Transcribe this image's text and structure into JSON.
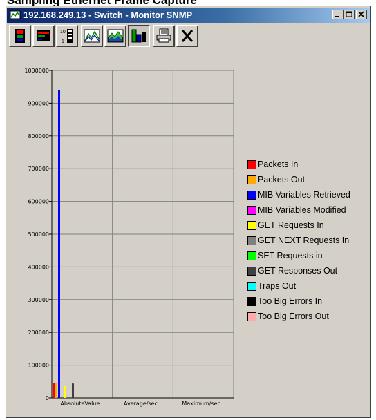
{
  "page_heading_fragment": "Sampling Ethernet Frame Capture",
  "window": {
    "title": "192.168.249.13 - Switch - Monitor SNMP"
  },
  "toolbar": {
    "buttons": [
      {
        "icon": "stacked-bar-vertical-icon"
      },
      {
        "icon": "stacked-bar-horizontal-icon"
      },
      {
        "icon": "scale-bar-icon"
      },
      {
        "icon": "line-chart-icon"
      },
      {
        "icon": "area-chart-icon"
      },
      {
        "icon": "bar-chart-icon",
        "pressed": true
      },
      {
        "icon": "print-icon"
      },
      {
        "icon": "close-icon"
      }
    ]
  },
  "chart_data": {
    "type": "bar",
    "categories": [
      "AbsoluteValue",
      "Average/sec",
      "Maximum/sec"
    ],
    "ylim": [
      0,
      1000000
    ],
    "yticks": [
      "0",
      "100000",
      "200000",
      "300000",
      "400000",
      "500000",
      "600000",
      "700000",
      "800000",
      "900000",
      "1000000"
    ],
    "grid": true,
    "legend_position": "right",
    "series": [
      {
        "name": "Packets In",
        "color": "#ff0000",
        "values": [
          45000,
          0,
          0
        ]
      },
      {
        "name": "Packets Out",
        "color": "#ffaa00",
        "values": [
          45000,
          0,
          0
        ]
      },
      {
        "name": "MIB Variables Retrieved",
        "color": "#0000ff",
        "values": [
          940000,
          0,
          0
        ]
      },
      {
        "name": "MIB Variables Modified",
        "color": "#ff00ff",
        "values": [
          0,
          0,
          0
        ]
      },
      {
        "name": "GET Requests In",
        "color": "#ffff00",
        "values": [
          36000,
          0,
          0
        ]
      },
      {
        "name": "GET NEXT Requests In",
        "color": "#808080",
        "values": [
          0,
          0,
          0
        ]
      },
      {
        "name": "SET Requests in",
        "color": "#00ff00",
        "values": [
          0,
          0,
          0
        ]
      },
      {
        "name": "GET Responses Out",
        "color": "#404040",
        "values": [
          44000,
          0,
          0
        ]
      },
      {
        "name": "Traps Out",
        "color": "#00ffff",
        "values": [
          0,
          0,
          0
        ]
      },
      {
        "name": "Too Big Errors In",
        "color": "#000000",
        "values": [
          0,
          0,
          0
        ]
      },
      {
        "name": "Too Big Errors Out",
        "color": "#ffaaaa",
        "values": [
          0,
          0,
          0
        ]
      }
    ]
  }
}
